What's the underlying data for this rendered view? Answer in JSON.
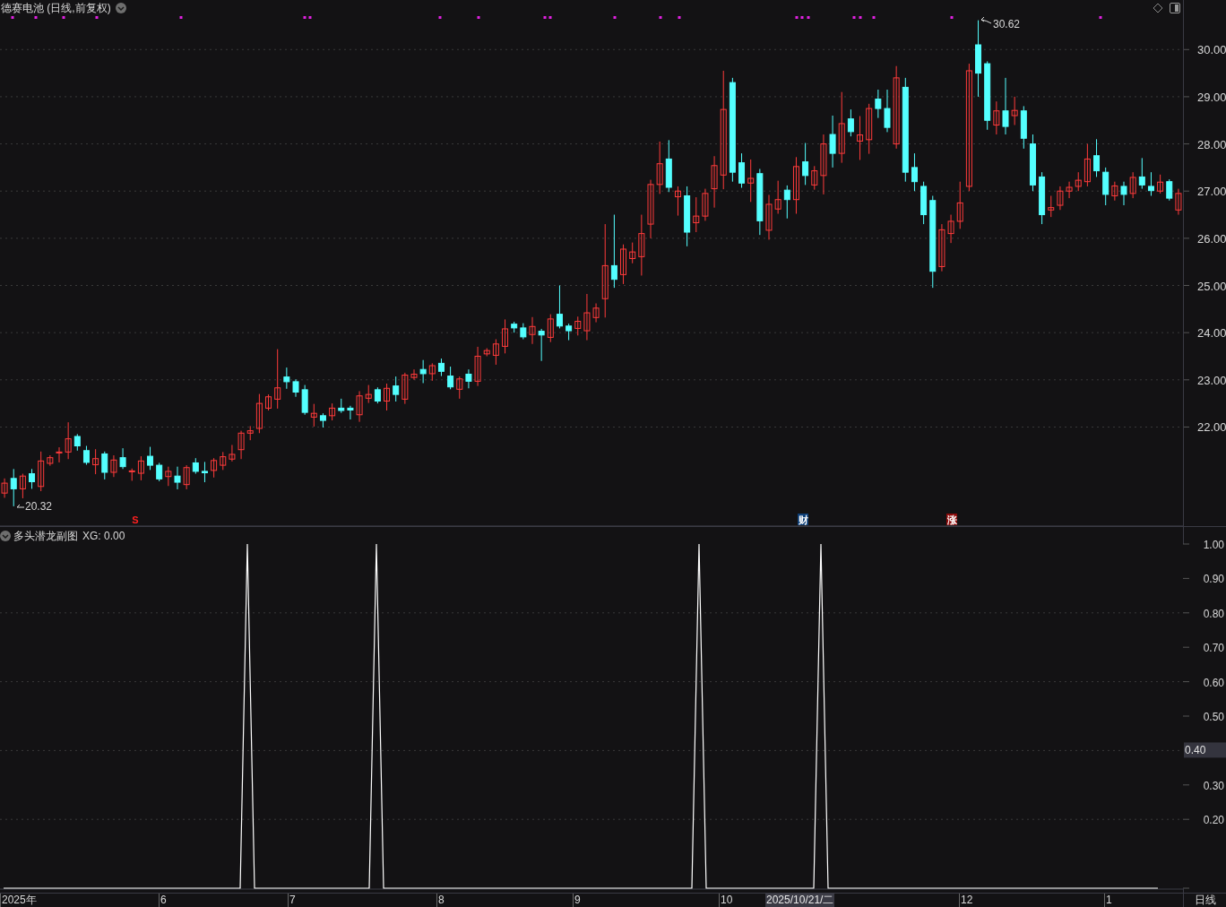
{
  "main_chart": {
    "title": "德赛电池 (日线,前复权)",
    "high_label": "30.62",
    "low_label": "20.32",
    "event_markers": [
      {
        "kind": "signal",
        "text": "S"
      },
      {
        "kind": "finance",
        "text": "财"
      },
      {
        "kind": "limit_up",
        "text": "涨"
      }
    ],
    "chart_data": {
      "type": "candlestick",
      "grid": true,
      "ylim": [
        19.9,
        31.05
      ],
      "yticks": [
        {
          "value": 30,
          "label": "30.00"
        },
        {
          "value": 29,
          "label": "29.00"
        },
        {
          "value": 28,
          "label": "28.00"
        },
        {
          "value": 27,
          "label": "27.00"
        },
        {
          "value": 26,
          "label": "26.00"
        },
        {
          "value": 25,
          "label": "25.00"
        },
        {
          "value": 24,
          "label": "24.00"
        },
        {
          "value": 23,
          "label": "23.00"
        },
        {
          "value": 22,
          "label": "22.00"
        }
      ],
      "ohlc": [
        [
          20.6,
          20.91,
          20.5,
          20.81
        ],
        [
          20.91,
          21.11,
          20.32,
          20.69
        ],
        [
          20.69,
          21.01,
          20.49,
          20.96
        ],
        [
          21.01,
          21.11,
          20.69,
          20.84
        ],
        [
          20.74,
          21.48,
          20.64,
          21.28
        ],
        [
          21.23,
          21.4,
          21.18,
          21.35
        ],
        [
          21.45,
          21.57,
          21.25,
          21.47
        ],
        [
          21.47,
          22.1,
          21.32,
          21.75
        ],
        [
          21.8,
          21.85,
          21.5,
          21.6
        ],
        [
          21.5,
          21.6,
          21.2,
          21.25
        ],
        [
          21.2,
          21.53,
          21.0,
          21.33
        ],
        [
          21.43,
          21.48,
          20.89,
          21.04
        ],
        [
          21.04,
          21.4,
          20.94,
          21.3
        ],
        [
          21.35,
          21.55,
          21.11,
          21.16
        ],
        [
          21.06,
          21.12,
          20.86,
          21.07
        ],
        [
          21.02,
          21.38,
          20.87,
          21.28
        ],
        [
          21.38,
          21.58,
          21.09,
          21.19
        ],
        [
          21.19,
          21.24,
          20.85,
          20.9
        ],
        [
          20.95,
          21.16,
          20.75,
          21.06
        ],
        [
          20.96,
          21.16,
          20.68,
          20.83
        ],
        [
          20.78,
          21.19,
          20.68,
          21.14
        ],
        [
          21.24,
          21.34,
          21.01,
          21.06
        ],
        [
          21.06,
          21.26,
          20.83,
          21.03
        ],
        [
          21.08,
          21.34,
          20.93,
          21.29
        ],
        [
          21.19,
          21.47,
          21.09,
          21.37
        ],
        [
          21.32,
          21.62,
          21.27,
          21.42
        ],
        [
          21.52,
          21.92,
          21.32,
          21.87
        ],
        [
          21.87,
          22.02,
          21.72,
          21.92
        ],
        [
          21.97,
          22.7,
          21.87,
          22.5
        ],
        [
          22.4,
          22.69,
          22.35,
          22.64
        ],
        [
          22.59,
          23.65,
          22.39,
          22.83
        ],
        [
          23.06,
          23.26,
          22.81,
          22.96
        ],
        [
          22.96,
          23.01,
          22.64,
          22.74
        ],
        [
          22.79,
          22.89,
          22.26,
          22.31
        ],
        [
          22.21,
          22.49,
          22.01,
          22.29
        ],
        [
          22.24,
          22.29,
          21.99,
          22.14
        ],
        [
          22.24,
          22.5,
          22.14,
          22.4
        ],
        [
          22.4,
          22.6,
          22.3,
          22.35
        ],
        [
          22.4,
          22.45,
          22.16,
          22.36
        ],
        [
          22.26,
          22.76,
          22.11,
          22.66
        ],
        [
          22.61,
          22.89,
          22.51,
          22.69
        ],
        [
          22.79,
          22.84,
          22.5,
          22.55
        ],
        [
          22.55,
          22.92,
          22.35,
          22.82
        ],
        [
          22.87,
          23.07,
          22.54,
          22.69
        ],
        [
          22.59,
          23.15,
          22.49,
          23.1
        ],
        [
          23.05,
          23.22,
          23.0,
          23.12
        ],
        [
          23.22,
          23.42,
          22.93,
          23.13
        ],
        [
          23.13,
          23.35,
          22.98,
          23.3
        ],
        [
          23.35,
          23.45,
          23.08,
          23.18
        ],
        [
          23.08,
          23.28,
          22.8,
          22.85
        ],
        [
          22.8,
          23.07,
          22.6,
          23.02
        ],
        [
          23.12,
          23.22,
          22.82,
          22.97
        ],
        [
          22.97,
          23.7,
          22.87,
          23.5
        ],
        [
          23.55,
          23.67,
          23.5,
          23.62
        ],
        [
          23.52,
          23.86,
          23.32,
          23.76
        ],
        [
          23.71,
          24.28,
          23.56,
          24.08
        ],
        [
          24.18,
          24.23,
          24.0,
          24.1
        ],
        [
          24.1,
          24.2,
          23.86,
          23.91
        ],
        [
          23.96,
          24.33,
          23.76,
          24.13
        ],
        [
          24.03,
          24.08,
          23.4,
          23.95
        ],
        [
          23.9,
          24.39,
          23.8,
          24.29
        ],
        [
          24.39,
          25.0,
          24.09,
          24.14
        ],
        [
          24.14,
          24.19,
          23.84,
          24.04
        ],
        [
          24.09,
          24.34,
          23.94,
          24.24
        ],
        [
          24.04,
          24.82,
          23.84,
          24.42
        ],
        [
          24.32,
          24.62,
          24.22,
          24.52
        ],
        [
          24.72,
          26.3,
          24.32,
          25.42
        ],
        [
          25.42,
          26.5,
          24.95,
          25.13
        ],
        [
          25.23,
          25.87,
          25.03,
          25.77
        ],
        [
          25.57,
          25.91,
          25.47,
          25.71
        ],
        [
          25.61,
          26.5,
          25.21,
          26.1
        ],
        [
          26.3,
          27.24,
          26.0,
          27.14
        ],
        [
          27.14,
          28.05,
          26.94,
          27.58
        ],
        [
          27.68,
          28.08,
          26.98,
          27.08
        ],
        [
          26.88,
          27.1,
          26.48,
          27.0
        ],
        [
          26.9,
          27.1,
          25.83,
          26.13
        ],
        [
          26.33,
          26.87,
          26.13,
          26.47
        ],
        [
          26.47,
          27.05,
          26.37,
          26.95
        ],
        [
          27.05,
          27.74,
          26.65,
          27.54
        ],
        [
          27.34,
          29.55,
          27.04,
          28.73
        ],
        [
          29.3,
          29.4,
          27.2,
          27.4
        ],
        [
          27.6,
          27.8,
          27.07,
          27.17
        ],
        [
          27.17,
          27.67,
          26.77,
          27.27
        ],
        [
          27.37,
          27.47,
          26.07,
          26.37
        ],
        [
          26.17,
          26.92,
          25.97,
          26.72
        ],
        [
          26.62,
          27.22,
          26.52,
          26.82
        ],
        [
          27.02,
          27.12,
          26.42,
          26.82
        ],
        [
          26.82,
          27.72,
          26.52,
          27.52
        ],
        [
          27.62,
          28.02,
          27.13,
          27.33
        ],
        [
          27.13,
          27.53,
          27.03,
          27.43
        ],
        [
          27.33,
          28.2,
          26.93,
          28.0
        ],
        [
          28.2,
          28.6,
          27.5,
          27.8
        ],
        [
          27.8,
          29.1,
          27.6,
          28.43
        ],
        [
          28.53,
          28.73,
          28.16,
          28.26
        ],
        [
          28.06,
          28.59,
          27.66,
          28.19
        ],
        [
          28.09,
          28.85,
          27.79,
          28.75
        ],
        [
          28.95,
          29.15,
          28.55,
          28.75
        ],
        [
          28.75,
          29.15,
          28.25,
          28.35
        ],
        [
          28.0,
          29.65,
          27.9,
          29.4
        ],
        [
          29.2,
          29.4,
          27.2,
          27.4
        ],
        [
          27.5,
          27.8,
          27.0,
          27.2
        ],
        [
          27.1,
          27.2,
          26.3,
          26.5
        ],
        [
          26.8,
          26.9,
          24.95,
          25.3
        ],
        [
          25.4,
          26.3,
          25.3,
          26.18
        ],
        [
          26.1,
          26.5,
          25.9,
          26.36
        ],
        [
          26.36,
          27.2,
          26.2,
          26.75
        ],
        [
          27.1,
          29.7,
          27.0,
          29.55
        ],
        [
          30.1,
          30.62,
          29.0,
          29.5
        ],
        [
          29.7,
          29.75,
          28.3,
          28.5
        ],
        [
          28.4,
          28.9,
          28.2,
          28.7
        ],
        [
          28.7,
          29.4,
          28.2,
          28.37
        ],
        [
          28.6,
          29.0,
          28.4,
          28.71
        ],
        [
          28.7,
          28.8,
          27.9,
          28.12
        ],
        [
          28.0,
          28.2,
          27.0,
          27.13
        ],
        [
          27.3,
          27.4,
          26.3,
          26.5
        ],
        [
          26.6,
          26.9,
          26.45,
          26.65
        ],
        [
          26.7,
          27.1,
          26.6,
          27.0
        ],
        [
          27.0,
          27.2,
          26.85,
          27.08
        ],
        [
          27.1,
          27.4,
          27.0,
          27.23
        ],
        [
          27.2,
          28.0,
          27.1,
          27.68
        ],
        [
          27.75,
          28.1,
          27.3,
          27.43
        ],
        [
          27.4,
          27.5,
          26.7,
          26.93
        ],
        [
          26.9,
          27.2,
          26.8,
          27.11
        ],
        [
          27.1,
          27.2,
          26.7,
          26.93
        ],
        [
          26.95,
          27.4,
          26.85,
          27.29
        ],
        [
          27.3,
          27.7,
          27.05,
          27.13
        ],
        [
          27.1,
          27.4,
          26.9,
          27.01
        ],
        [
          27.0,
          27.35,
          26.95,
          27.19
        ],
        [
          27.2,
          27.25,
          26.8,
          26.85
        ],
        [
          26.6,
          27.05,
          26.5,
          26.95
        ]
      ]
    }
  },
  "indicator": {
    "title": "多头潜龙副图",
    "reading": "XG: 0.00",
    "axis_marker": "0.40",
    "chart_data": {
      "type": "line",
      "grid": true,
      "ylim": [
        0,
        1
      ],
      "yticks": [
        {
          "value": 1,
          "label": "1.00"
        },
        {
          "value": 0.9,
          "label": "0.90"
        },
        {
          "value": 0.8,
          "label": "0.80"
        },
        {
          "value": 0.7,
          "label": "0.70"
        },
        {
          "value": 0.6,
          "label": "0.60"
        },
        {
          "value": 0.5,
          "label": "0.50"
        },
        {
          "value": 0.3,
          "label": "0.30"
        },
        {
          "value": 0.2,
          "label": "0.20"
        }
      ],
      "series": [
        {
          "color": "#ffffff",
          "values": [
            0,
            0,
            0,
            0,
            0,
            0,
            0,
            0,
            0,
            0,
            0,
            0,
            0,
            0,
            0,
            0,
            0,
            0,
            0,
            0,
            0,
            0,
            0,
            0,
            0,
            0,
            0,
            0,
            0,
            0,
            0,
            0,
            0,
            0,
            1,
            0,
            0,
            0,
            0,
            0,
            0,
            0,
            0,
            0,
            0,
            0,
            0,
            0,
            0,
            0,
            0,
            0,
            1,
            0,
            0,
            0,
            0,
            0,
            0,
            0,
            0,
            0,
            0,
            0,
            0,
            0,
            0,
            0,
            0,
            0,
            0,
            0,
            0,
            0,
            0,
            0,
            0,
            0,
            0,
            0,
            0,
            0,
            0,
            0,
            0,
            0,
            0,
            0,
            0,
            0,
            0,
            0,
            0,
            0,
            0,
            0,
            0,
            1,
            0,
            0,
            0,
            0,
            0,
            0,
            0,
            0,
            0,
            0,
            0,
            0,
            0,
            0,
            0,
            0,
            1,
            0,
            0,
            0,
            0,
            0,
            0,
            0,
            0,
            0,
            0,
            0,
            0,
            0,
            0,
            0,
            0,
            0,
            0,
            0,
            0,
            0,
            0,
            0,
            0,
            0,
            0,
            0,
            0,
            0,
            0,
            0,
            0,
            0,
            0,
            0,
            0,
            0,
            0,
            0,
            0,
            0,
            0,
            0,
            0,
            0,
            0,
            0
          ]
        }
      ]
    }
  },
  "xaxis": {
    "labels": [
      "2025年",
      "6",
      "7",
      "8",
      "9",
      "10",
      "12",
      "1"
    ],
    "cursor_date": "2025/10/21/二",
    "period": "日线"
  }
}
